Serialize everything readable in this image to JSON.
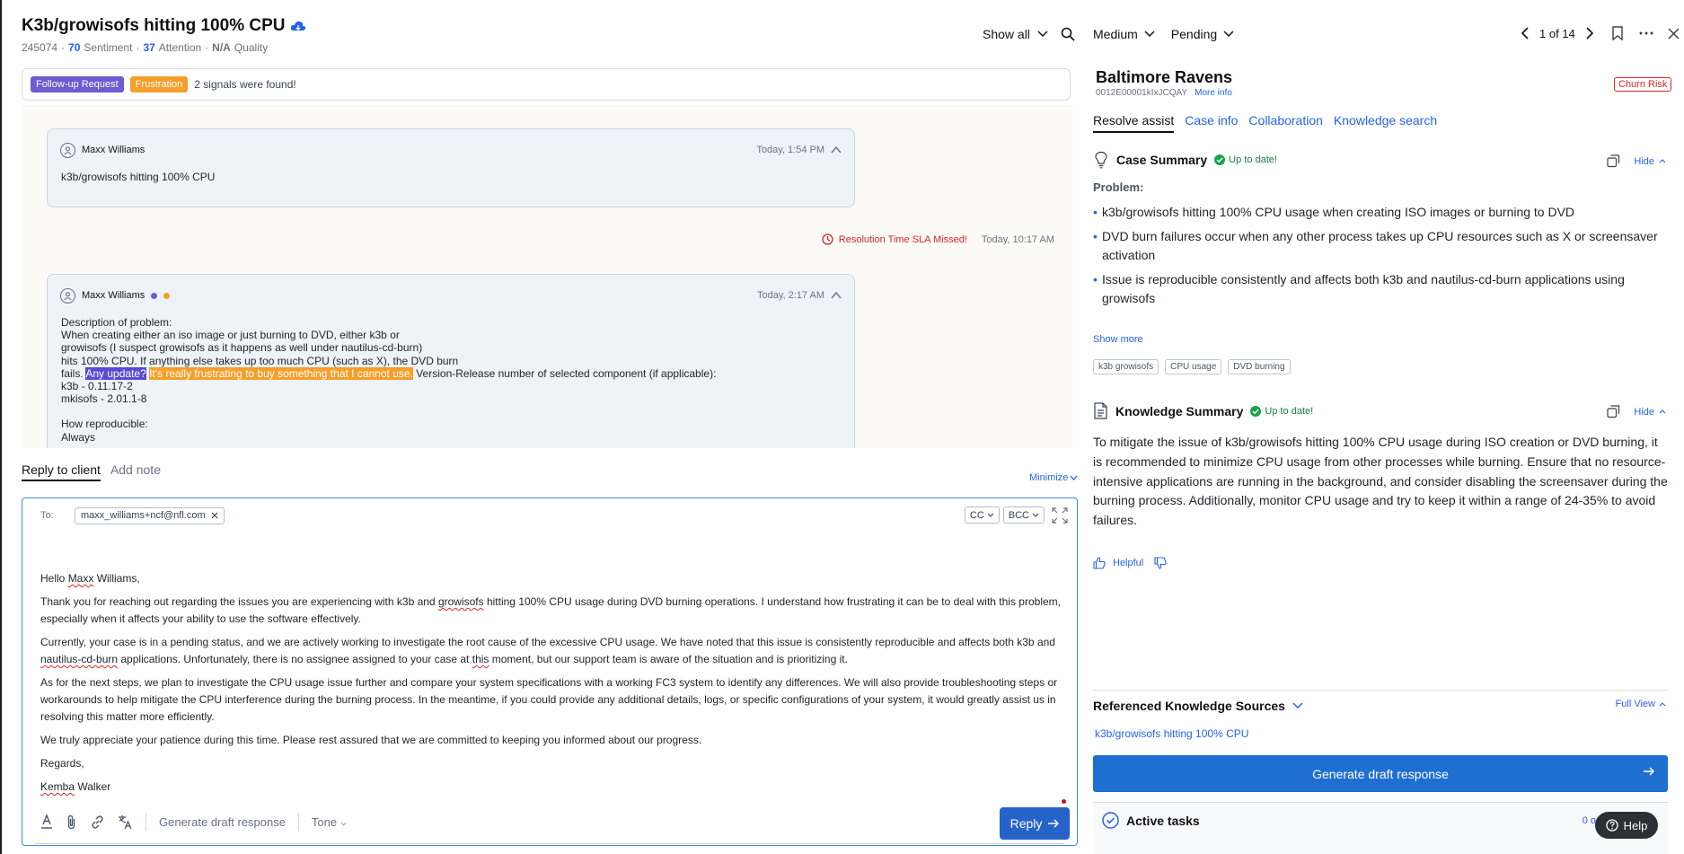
{
  "case": {
    "title": "K3b/growisofs hitting 100% CPU",
    "id": "245074",
    "sentiment_value": "70",
    "sentiment_label": "Sentiment",
    "attention_value": "37",
    "attention_label": "Attention",
    "quality_value": "N/A",
    "quality_label": "Quality",
    "show_all": "Show all"
  },
  "signals": {
    "tags": [
      "Follow-up Request",
      "Frustration"
    ],
    "text": "2 signals were found!"
  },
  "thread": {
    "msg1": {
      "author": "Maxx Williams",
      "time": "Today, 1:54 PM",
      "body": "k3b/growisofs hitting 100% CPU"
    },
    "sla": {
      "text": "Resolution Time SLA Missed!",
      "time": "Today, 10:17 AM"
    },
    "msg2": {
      "author": "Maxx Williams",
      "time": "Today, 2:17 AM",
      "lines": [
        "Description of problem:",
        "When creating either an iso image or just burning to DVD, either k3b or",
        "growisofs (I suspect growisofs as it happens as well under nautilus-cd-burn)",
        "hits 100% CPU. If anything else takes up too much CPU (such as X), the DVD burn"
      ],
      "fails_prefix": "fails.",
      "highlight_blue": "Any update?",
      "highlight_orange": "It's really frustrating to buy something that I cannot use.",
      "fails_suffix": "Version-Release number of selected component (if applicable):",
      "lines2": [
        "k3b - 0.11.17-2",
        "mkisofs - 2.01.1-8"
      ],
      "repro_label": "How reproducible:",
      "repro_value": "Always"
    }
  },
  "reply": {
    "tab_active": "Reply to client",
    "tab_other": "Add note",
    "minimize": "Minimize",
    "to_label": "To:",
    "to_chip": "maxx_williams+ncf@nfl.com",
    "cc": "CC",
    "bcc": "BCC",
    "greeting_pre": "Hello ",
    "greeting_name": "Maxx",
    "greeting_post": " Williams,",
    "p1_a": "Thank you for reaching out regarding the issues you are experiencing with k3b and ",
    "p1_sq": "growisofs",
    "p1_b": " hitting 100% CPU usage during DVD burning operations. I understand how frustrating it can be to deal with this problem, especially when it affects your ability to use the software effectively.",
    "p2_a": "Currently, your case is in a pending status, and we are actively working to investigate the root cause of the excessive CPU usage. We have noted that this issue is consistently reproducible and affects both k3b and ",
    "p2_sq": "nautilus-cd-burn",
    "p2_b": " applications. Unfortunately, there is no assignee assigned to your case at ",
    "p2_sq2": "this",
    "p2_c": " moment, but our support team is aware of the situation and is prioritizing it.",
    "p3": "As for the next steps, we plan to investigate the CPU usage issue further and compare your system specifications with a working FC3 system to identify any differences. We will also provide troubleshooting steps or workarounds to help mitigate the CPU interference during the burning process. In the meantime, if you could provide any additional details, logs, or specific configurations of your system, it would greatly assist us in resolving this matter more efficiently.",
    "p4": "We truly appreciate your patience during this time. Please rest assured that we are committed to keeping you informed about our progress.",
    "regards": "Regards,",
    "sig_first": "Kemba",
    "sig_last": " Walker",
    "gen_draft": "Generate draft response",
    "tone": "Tone",
    "send": "Reply"
  },
  "right": {
    "priority": "Medium",
    "status": "Pending",
    "pager": "1 of 14",
    "account": "Baltimore Ravens",
    "account_id": "0012E00001kIxJCQAY",
    "more_info": "More info",
    "churn": "Churn Risk",
    "tabs": [
      "Resolve assist",
      "Case info",
      "Collaboration",
      "Knowledge search"
    ],
    "case_summary": {
      "title": "Case Summary",
      "status": "Up to date!",
      "hide": "Hide",
      "problem_label": "Problem:",
      "bullets": [
        "k3b/growisofs hitting 100% CPU usage when creating ISO images or burning to DVD",
        "DVD burn failures occur when any other process takes up CPU resources such as X or screensaver activation",
        "Issue is reproducible consistently and affects both k3b and nautilus-cd-burn applications using growisofs"
      ],
      "show_more": "Show more",
      "tags": [
        "k3b growisofs",
        "CPU usage",
        "DVD burning"
      ]
    },
    "knowledge_summary": {
      "title": "Knowledge Summary",
      "status": "Up to date!",
      "hide": "Hide",
      "text": "To mitigate the issue of k3b/growisofs hitting 100% CPU usage during ISO creation or DVD burning, it is recommended to minimize CPU usage from other processes while burning. Ensure that no resource-intensive applications are running in the background, and consider disabling the screensaver during the burning process. Additionally, monitor CPU usage and try to keep it within a range of 24-35% to avoid failures.",
      "helpful": "Helpful"
    },
    "ref_sources": {
      "title": "Referenced Knowledge Sources",
      "full_view": "Full View",
      "link": "k3b/growisofs hitting 100% CPU"
    },
    "generate": "Generate draft response",
    "active_tasks": "Active tasks",
    "active_tasks_count": "0 o",
    "help": "Help"
  },
  "colors": {
    "accent": "#2563eb",
    "signal_purple": "#6d5bd0",
    "signal_orange": "#f59e2a",
    "danger": "#dc2626",
    "success": "#15803d"
  }
}
